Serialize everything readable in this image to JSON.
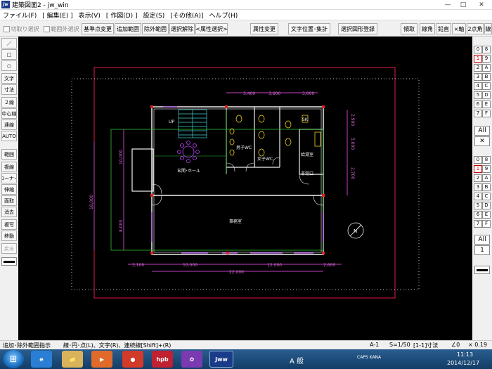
{
  "window": {
    "title": "建築図面2 - jw_win",
    "app_icon": "jw",
    "btn_min": "—",
    "btn_max": "□",
    "btn_close": "✕"
  },
  "menu": [
    "ファイル(F)",
    "[ 編集(E) ]",
    "表示(V)",
    "[ 作図(D) ]",
    "設定(S)",
    "[その他(A)]",
    "ヘルプ(H)"
  ],
  "toolbar": {
    "chk_kirito": "切取り選択",
    "chk_hanigai": "範囲外選択",
    "b1": "基準点変更",
    "b2": "追加範囲",
    "b3": "除外範囲",
    "b4": "選択解除",
    "b5": "<属性選択>",
    "b6": "属性変更",
    "b7": "文字位置･集計",
    "b8": "選択図形登録",
    "r1": "傾取",
    "r2": "線角",
    "r3": "鉛直",
    "r4": "×軸",
    "r5": "2点角",
    "r6": "線"
  },
  "left_tools": [
    {
      "label": "／",
      "enabled": true
    },
    {
      "label": "□",
      "enabled": true
    },
    {
      "label": "○",
      "enabled": true
    },
    {
      "label": "文字",
      "enabled": true
    },
    {
      "label": "寸法",
      "enabled": true
    },
    {
      "label": "２線",
      "enabled": true
    },
    {
      "label": "中心線",
      "enabled": true
    },
    {
      "label": "連線",
      "enabled": true
    },
    {
      "label": "AUTO",
      "enabled": true
    },
    {
      "label": "範囲",
      "enabled": true
    },
    {
      "label": "複線",
      "enabled": true
    },
    {
      "label": "コーナー",
      "enabled": true
    },
    {
      "label": "伸縮",
      "enabled": true
    },
    {
      "label": "面取",
      "enabled": true
    },
    {
      "label": "消去",
      "enabled": true
    },
    {
      "label": "複写",
      "enabled": true
    },
    {
      "label": "移動",
      "enabled": true
    },
    {
      "label": "戻る",
      "enabled": false
    }
  ],
  "right_tools": {
    "layer_groups_top": [
      [
        "0",
        "8"
      ],
      [
        "1",
        "9"
      ],
      [
        "2",
        "A"
      ],
      [
        "3",
        "B"
      ],
      [
        "4",
        "C"
      ],
      [
        "5",
        "D"
      ],
      [
        "6",
        "E"
      ],
      [
        "7",
        "F"
      ]
    ],
    "all_top": "All",
    "x_btn": "✕",
    "layer_groups_bottom": [
      [
        "0",
        "8"
      ],
      [
        "1",
        "9"
      ],
      [
        "2",
        "A"
      ],
      [
        "3",
        "B"
      ],
      [
        "4",
        "C"
      ],
      [
        "5",
        "D"
      ],
      [
        "6",
        "E"
      ],
      [
        "7",
        "F"
      ]
    ],
    "all_bottom": "All",
    "num_btn": "1"
  },
  "drawing": {
    "dims_top": [
      "3,400",
      "3,600",
      "3,000"
    ],
    "dims_bottom": [
      "3,100",
      "10,000",
      "12,000",
      "2,600"
    ],
    "dim_total": "22,000",
    "dims_right": [
      "2,900",
      "5,000",
      "2,700"
    ],
    "dims_left": [
      "10,000",
      "18,000",
      "8,000"
    ],
    "rooms": {
      "up": "UP",
      "hall": "玄関･ホール",
      "mens": "男子WC",
      "womens": "女子WC",
      "kyuto": "給湯室",
      "sk": "SK",
      "hijo": "非常口",
      "office": "事務室"
    },
    "north": "N"
  },
  "status": {
    "left": "追加･除外範囲指示",
    "mid": "線･円･点(L)、文字(R)、連続線[Shift]+(R)",
    "layer": "A-1",
    "scale": "S=1/50",
    "dim": "[1-1]寸法",
    "angle": "∠0",
    "zoom": "× 0.19"
  },
  "taskbar": {
    "start": "⊞",
    "apps": [
      "e",
      "📁",
      "▶",
      "●",
      "hpb",
      "✿",
      "Jww"
    ],
    "ime": "A 般",
    "caps": "CAPS KANA",
    "time": "11:13",
    "date": "2014/12/17"
  }
}
